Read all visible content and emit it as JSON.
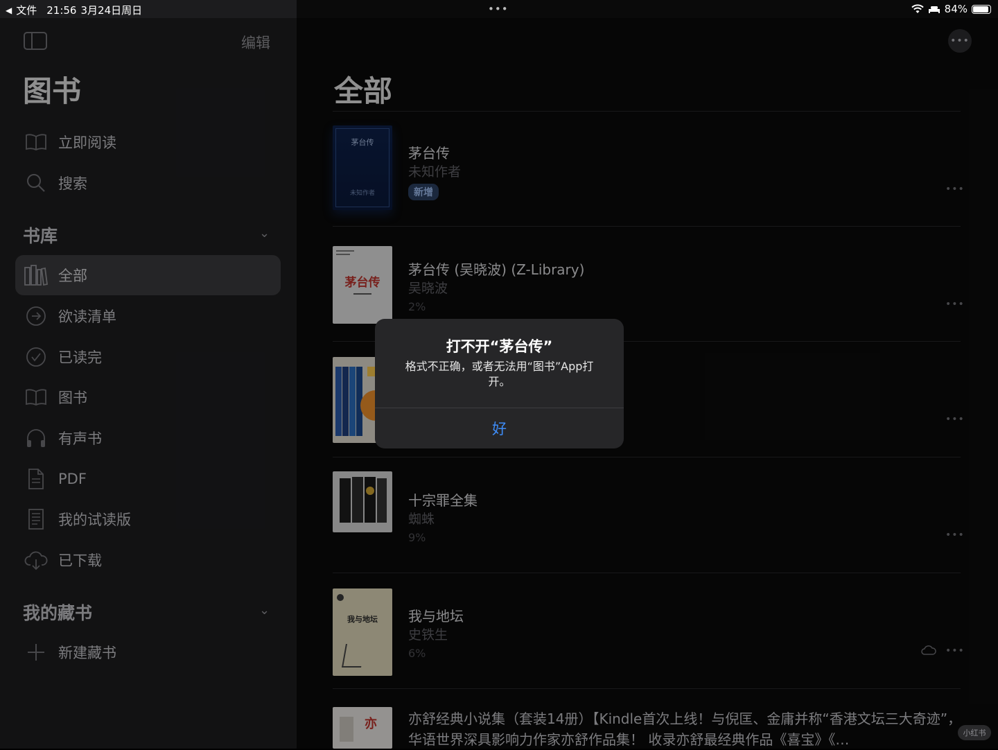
{
  "status_bar": {
    "back_label": "文件",
    "time": "21:56",
    "date": "3月24日周日",
    "battery": "84%",
    "battery_level": 0.84
  },
  "sidebar": {
    "edit_label": "编辑",
    "title": "图书",
    "top_items": [
      {
        "label": "立即阅读",
        "icon": "open-book-icon"
      },
      {
        "label": "搜索",
        "icon": "search-icon"
      }
    ],
    "library_header": "书库",
    "library_items": [
      {
        "label": "全部",
        "icon": "library-icon",
        "active": true
      },
      {
        "label": "欲读清单",
        "icon": "arrow-circle-icon"
      },
      {
        "label": "已读完",
        "icon": "check-circle-icon"
      },
      {
        "label": "图书",
        "icon": "open-book-icon"
      },
      {
        "label": "有声书",
        "icon": "headphones-icon"
      },
      {
        "label": "PDF",
        "icon": "document-icon"
      },
      {
        "label": "我的试读版",
        "icon": "sample-icon"
      },
      {
        "label": "已下载",
        "icon": "cloud-download-icon"
      }
    ],
    "collections_header": "我的藏书",
    "new_collection_label": "新建藏书"
  },
  "main": {
    "title": "全部",
    "books": [
      {
        "title": "茅台传",
        "author": "未知作者",
        "badge": "新增",
        "cover_title": "茅台传",
        "cover_author": "未知作者"
      },
      {
        "title": "茅台传 (吴晓波) (Z-Library)",
        "author": "吴晓波",
        "progress": "2%",
        "cover_title": "茅台传"
      },
      {
        "title": "",
        "author": "",
        "progress": ""
      },
      {
        "title": "十宗罪全集",
        "author": "蜘蛛",
        "progress": "9%"
      },
      {
        "title": "我与地坛",
        "author": "史铁生",
        "progress": "6%",
        "cover_title": "我与地坛"
      },
      {
        "title": "亦舒经典小说集（套装14册）【Kindle首次上线！与倪匡、金庸并称“香港文坛三大奇迹”，华语世界深具影响力作家亦舒作品集！ 收录亦舒最经典作品《喜宝》《…"
      }
    ]
  },
  "alert": {
    "title": "打不开“茅台传”",
    "message": "格式不正确，或者无法用“图书”App打开。",
    "ok_label": "好"
  },
  "watermark": "小红书",
  "colors": {
    "sidebar_bg": "#1c1c1e",
    "active_bg": "#3a3a3c",
    "accent": "#3e8cf7"
  }
}
